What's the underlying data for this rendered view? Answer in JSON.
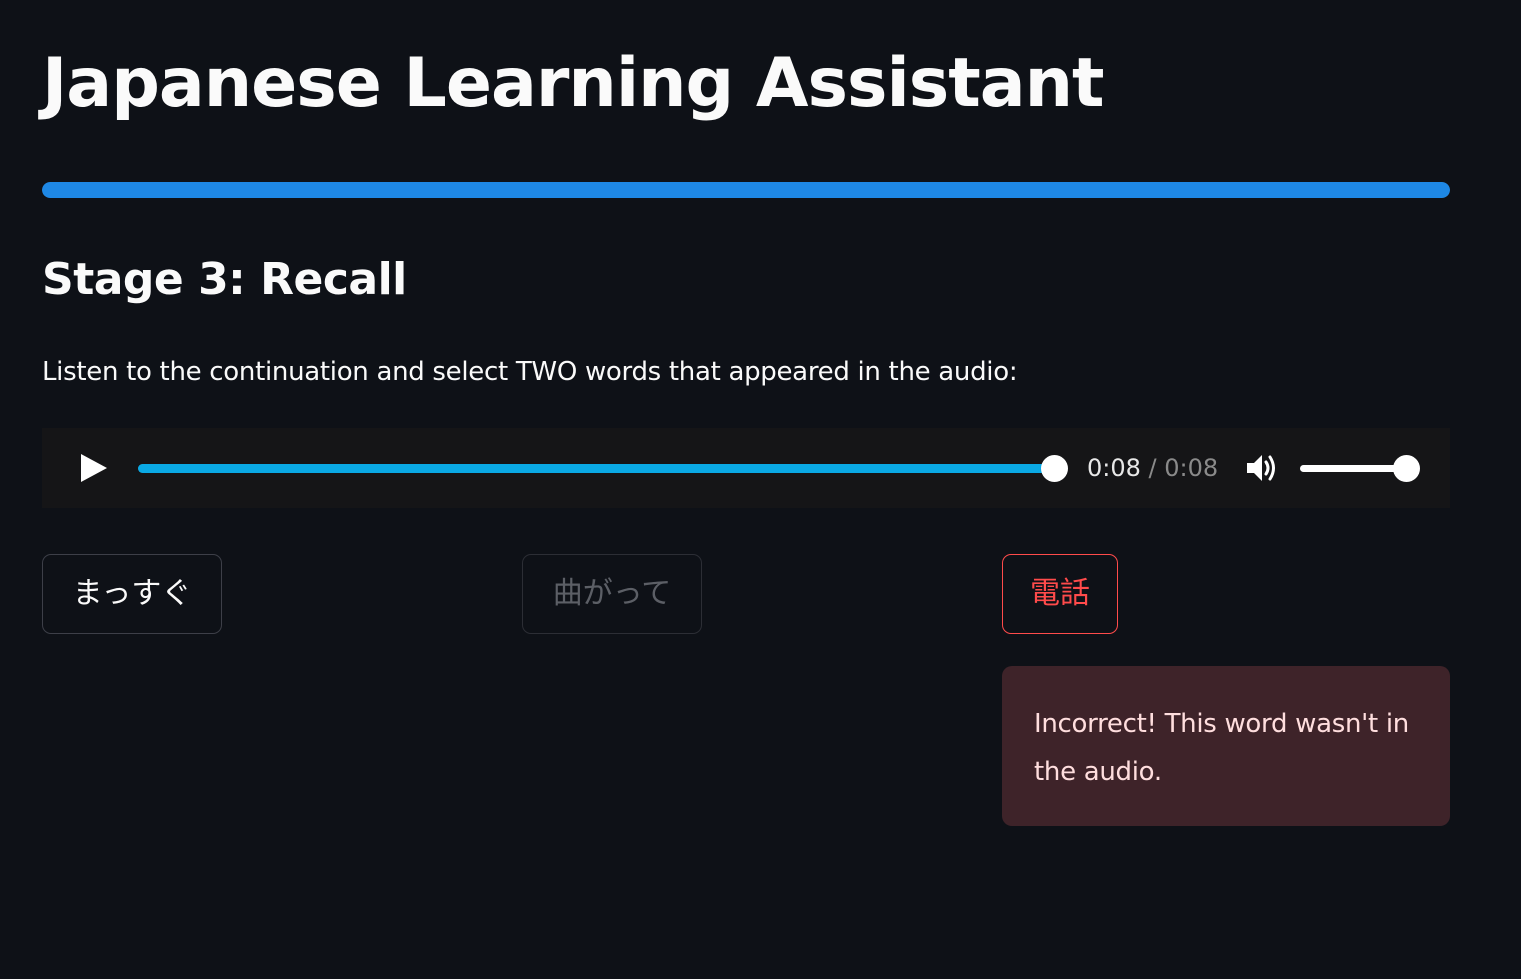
{
  "app": {
    "title": "Japanese Learning Assistant"
  },
  "progress": {
    "fraction": 1.0,
    "color": "#1e88e5"
  },
  "stage": {
    "heading": "Stage 3: Recall",
    "instructions": "Listen to the continuation and select TWO words that appeared in the audio:"
  },
  "audio_player": {
    "play_icon": "play-icon",
    "current_time": "0:08",
    "separator": "/",
    "total_time": "0:08",
    "playback_fraction": 1.0,
    "volume_icon": "volume-icon",
    "volume_fraction": 1.0,
    "accent_color": "#0aa9e5"
  },
  "word_options": [
    {
      "label": "まっすぐ",
      "state": "normal"
    },
    {
      "label": "曲がって",
      "state": "disabled"
    },
    {
      "label": "電話",
      "state": "incorrect"
    }
  ],
  "feedback": {
    "message": "Incorrect! This word wasn't in the audio.",
    "color": "#ff4b4b"
  }
}
